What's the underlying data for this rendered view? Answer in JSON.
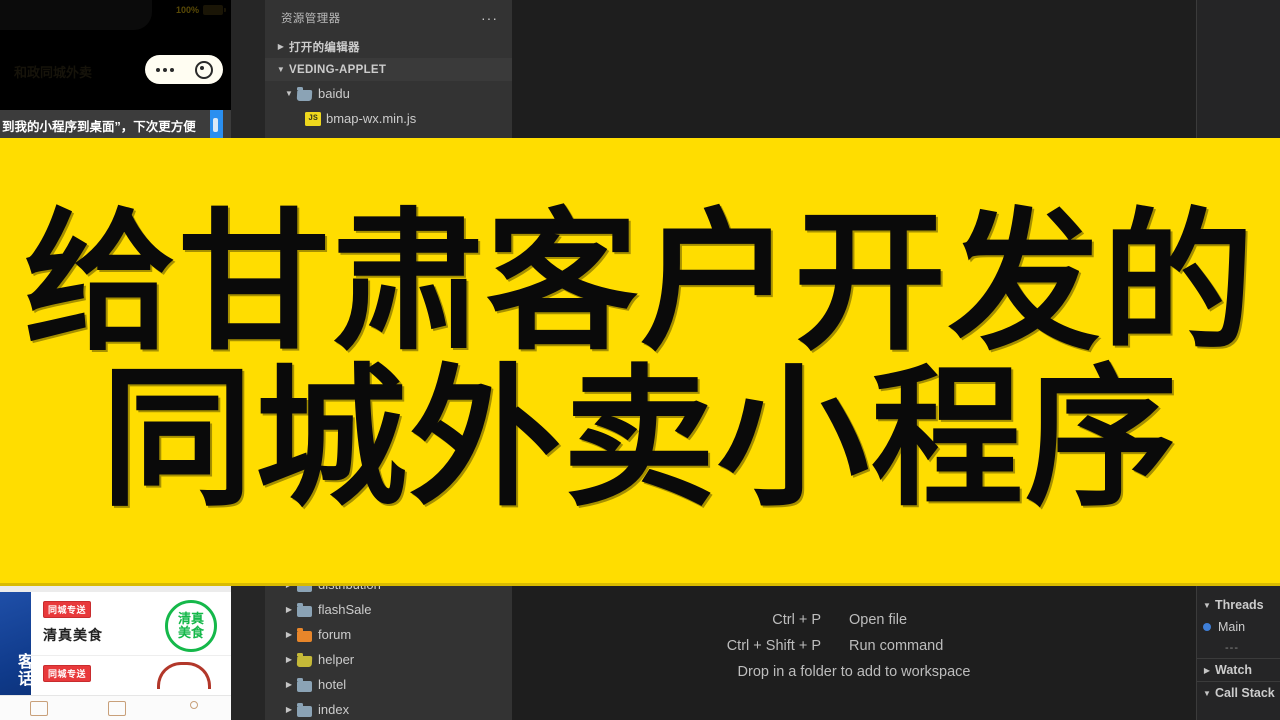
{
  "banner": {
    "line1": "给甘肃客户开发的",
    "line2": "同城外卖小程序",
    "background_color": "#ffdd00",
    "text_color": "#0a0a0a"
  },
  "phone_top": {
    "battery_percent": "100%",
    "app_title": "和政同城外卖",
    "tip_text": "到我的小程序到桌面”，下次更方便"
  },
  "phone_bottom": {
    "ad_text": "客话",
    "items": [
      {
        "badge": "同城专送",
        "name": "清真美食",
        "stamp": "清真美食"
      },
      {
        "badge": "同城专送",
        "name": "",
        "stamp": ""
      }
    ]
  },
  "sidebar": {
    "title": "资源管理器",
    "more_label": "···",
    "sections": [
      {
        "label": "打开的编辑器",
        "expanded": false
      },
      {
        "label": "VEDING-APPLET",
        "expanded": true
      }
    ],
    "tree_top": [
      {
        "label": "baidu",
        "type": "folder",
        "color": "#8ba3b5",
        "expanded": true,
        "depth": 1
      },
      {
        "label": "bmap-wx.min.js",
        "type": "js",
        "icon_text": "JS",
        "depth": 2
      }
    ],
    "tree_bottom": [
      {
        "label": "distribution",
        "type": "folder",
        "color": "#8ba3b5",
        "depth": 1
      },
      {
        "label": "flashSale",
        "type": "folder",
        "color": "#8ba3b5",
        "depth": 1
      },
      {
        "label": "forum",
        "type": "folder",
        "color": "#e8862a",
        "depth": 1
      },
      {
        "label": "helper",
        "type": "folder",
        "color": "#c5b938",
        "depth": 1
      },
      {
        "label": "hotel",
        "type": "folder",
        "color": "#8ba3b5",
        "depth": 1
      },
      {
        "label": "index",
        "type": "folder",
        "color": "#8ba3b5",
        "depth": 1
      }
    ]
  },
  "editor": {
    "shortcuts": [
      {
        "combo": "Ctrl + P",
        "desc": "Open file"
      },
      {
        "combo": "Ctrl + Shift + P",
        "desc": "Run command"
      }
    ],
    "drop_hint": "Drop in a folder to add to workspace"
  },
  "debug_panel": {
    "threads_label": "Threads",
    "main_thread": "Main",
    "dashes": "---",
    "watch_label": "Watch",
    "call_stack_label": "Call Stack",
    "thread_dot_color": "#3f7fd8"
  }
}
